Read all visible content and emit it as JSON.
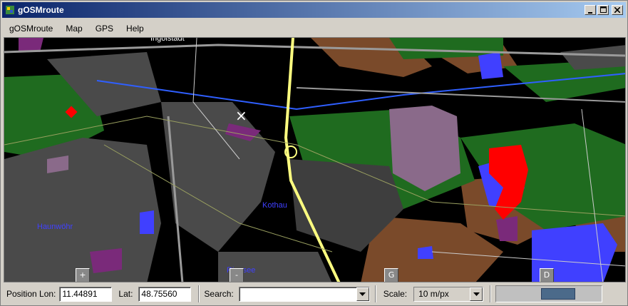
{
  "window": {
    "title": "gOSMroute"
  },
  "menu": {
    "items": [
      {
        "label": "gOSMroute"
      },
      {
        "label": "Map"
      },
      {
        "label": "GPS"
      },
      {
        "label": "Help"
      }
    ]
  },
  "map": {
    "labels": {
      "top": "Ingolstadt",
      "left": "Haunwöhr",
      "center": "Kothau",
      "bottom": "Ringsee"
    },
    "buttons": {
      "zoom_in": "+",
      "zoom_out": "-",
      "g": "G",
      "d": "D"
    },
    "marker": "×"
  },
  "status": {
    "lon_label": "Position Lon:",
    "lon_value": "11.44891",
    "lat_label": "Lat:",
    "lat_value": "48.75560",
    "search_label": "Search:",
    "search_value": "",
    "scale_label": "Scale:",
    "scale_value": "10 m/px",
    "progress": 0.33
  },
  "colors": {
    "title_start": "#0a246a",
    "title_end": "#a6caf0",
    "forest": "#1f6b1f",
    "residential": "#4a4a4a",
    "industrial": "#8a6a8a",
    "farmland": "#7a4a2a",
    "water": "#4040ff",
    "red_area": "#ff0000",
    "motorway": "#ffff80"
  }
}
